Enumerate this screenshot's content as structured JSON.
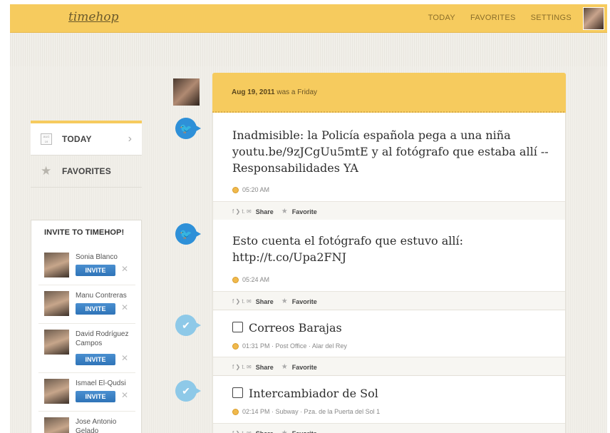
{
  "header": {
    "logo": "timehop",
    "nav": [
      "TODAY",
      "FAVORITES",
      "SETTINGS"
    ]
  },
  "sidebar": {
    "items": [
      {
        "label": "TODAY",
        "icon": "calendar-icon",
        "calendar_text": "AUG 19"
      },
      {
        "label": "FAVORITES",
        "icon": "star-icon"
      }
    ]
  },
  "invite": {
    "title": "INVITE TO TIMEHOP!",
    "button_label": "INVITE",
    "dismiss": "✕",
    "friends": [
      {
        "name": "Sonia Blanco"
      },
      {
        "name": "Manu Contreras"
      },
      {
        "name": "David Rodríguez Campos"
      },
      {
        "name": "Ismael El-Qudsi"
      },
      {
        "name": "Jose Antonio Gelado"
      }
    ]
  },
  "timeline": {
    "date": "Aug 19, 2011",
    "date_suffix": " was a Friday",
    "share_icons": "f ❯ t. ✉",
    "share_label": "Share",
    "favorite_label": "Favorite",
    "posts": [
      {
        "source": "twitter",
        "text": "Inadmisible: la Policía española pega a una niña youtu.be/9zJCgUu5mtE y al fotógrafo que estaba allí -- Responsabilidades YA",
        "time": "05:20 AM"
      },
      {
        "source": "twitter",
        "text": "Esto cuenta el fotógrafo que estuvo allí: http://t.co/Upa2FNJ",
        "time": "05:24 AM"
      },
      {
        "source": "foursquare",
        "text": "Correos Barajas",
        "time": "01:31 PM",
        "detail": "· Post Office · Alar del Rey",
        "place_icon": "mail-icon"
      },
      {
        "source": "foursquare",
        "text": "Intercambiador de Sol",
        "time": "02:14 PM",
        "detail": "· Subway · Pza. de la Puerta del Sol 1",
        "place_icon": "subway-icon"
      }
    ]
  },
  "colors": {
    "brand_yellow": "#f6cb5e",
    "twitter_blue": "#2e90d8",
    "foursquare_blue": "#8ec9e8",
    "invite_blue": "#2f74b8"
  }
}
